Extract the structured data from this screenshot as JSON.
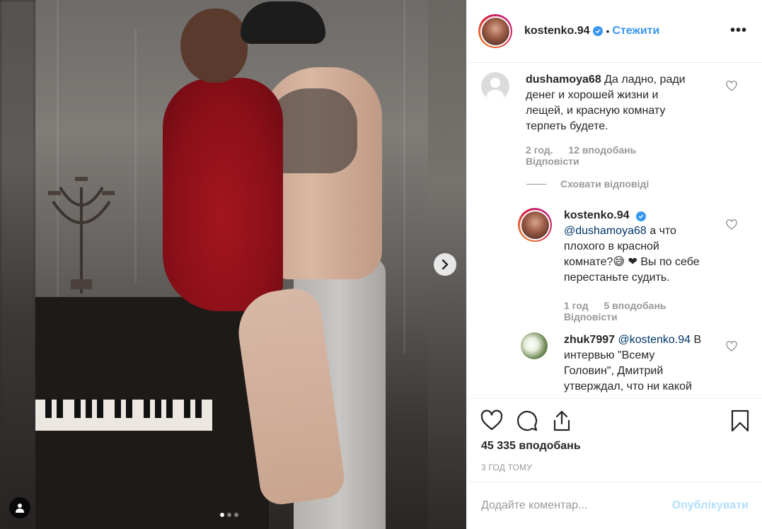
{
  "post": {
    "author": "kostenko.94",
    "separator": "•",
    "follow_label": "Стежити",
    "more_label": "•••",
    "carousel": {
      "total": 3,
      "active": 1
    }
  },
  "comments": [
    {
      "username": "dushamoya68",
      "text": "Да ладно, ради денег и хорошей жизни и лещей, и красную комнату терпеть будете.",
      "line1": "Да ладно, ради",
      "line2": "денег и хорошей жизни и",
      "line3": "лещей, и красную комнату",
      "line4": "терпеть будете.",
      "age": "2 год.",
      "likes": "12 вподобань",
      "reply_label": "Відповісти",
      "hide_replies_label": "Сховати відповіді"
    },
    {
      "username": "kostenko.94",
      "mention": "@dushamoya68",
      "line1": "а что",
      "line2": "плохого в красной",
      "line3": "комнате?😅 ❤ Вы по себе",
      "line4": "перестаньте судить.",
      "age": "1 год",
      "likes": "5 вподобань",
      "reply_label": "Відповісти"
    },
    {
      "username": "zhuk7997",
      "mention": "@kostenko.94",
      "line1": "В",
      "line2": "интервью \"Всему",
      "line3": "Головин\", Дмитрий",
      "line4": "утверждал, что ни какой"
    }
  ],
  "footer": {
    "likes": "45 335 вподобань",
    "timestamp": "3 ГОД ТОМУ",
    "comment_placeholder": "Додайте коментар...",
    "publish_label": "Опублікувати"
  },
  "colors": {
    "accent": "#3897f0",
    "publish_disabled": "#b2dffc",
    "meta_grey": "#999999",
    "dress_red": "#8a0f18"
  },
  "icons": {
    "next": "chevron-right-icon",
    "user_tag": "user-icon",
    "like": "heart-icon",
    "comment": "comment-icon",
    "share": "share-icon",
    "save": "bookmark-icon",
    "verified": "verified-badge-icon"
  }
}
